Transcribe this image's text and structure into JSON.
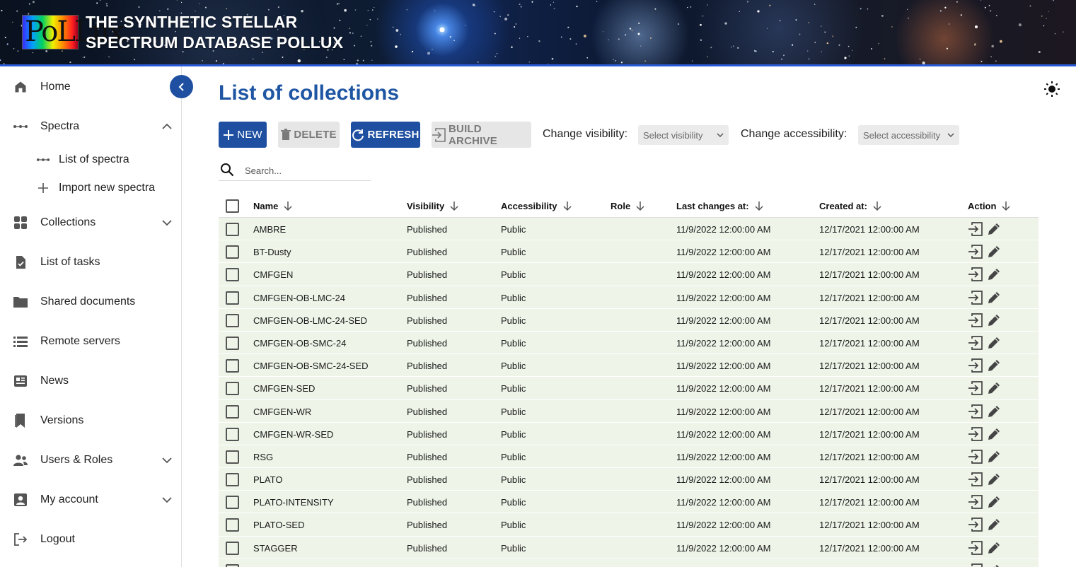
{
  "header": {
    "logo_text": "PoLLux",
    "title_line1": "THE SYNTHETIC STELLAR",
    "title_line2": "SPECTRUM DATABASE POLLUX"
  },
  "sidebar": {
    "items": [
      {
        "label": "Home"
      },
      {
        "label": "Spectra"
      },
      {
        "label": "List of spectra"
      },
      {
        "label": "Import new spectra"
      },
      {
        "label": "Collections"
      },
      {
        "label": "List of tasks"
      },
      {
        "label": "Shared documents"
      },
      {
        "label": "Remote servers"
      },
      {
        "label": "News"
      },
      {
        "label": "Versions"
      },
      {
        "label": "Users & Roles"
      },
      {
        "label": "My account"
      },
      {
        "label": "Logout"
      }
    ]
  },
  "main": {
    "title": "List of collections",
    "toolbar": {
      "new_label": "NEW",
      "delete_label": "DELETE",
      "refresh_label": "REFRESH",
      "build_archive_label": "BUILD ARCHIVE",
      "visibility_label": "Change visibility:",
      "visibility_placeholder": "Select visibility",
      "accessibility_label": "Change accessibility:",
      "accessibility_placeholder": "Select accessibility"
    },
    "search": {
      "placeholder": "Search..."
    },
    "table": {
      "columns": [
        "Name",
        "Visibility",
        "Accessibility",
        "Role",
        "Last changes at:",
        "Created at:",
        "Action"
      ],
      "rows": [
        {
          "name": "AMBRE",
          "visibility": "Published",
          "accessibility": "Public",
          "role": "",
          "last_changes": "11/9/2022 12:00:00 AM",
          "created": "12/17/2021 12:00:00 AM"
        },
        {
          "name": "BT-Dusty",
          "visibility": "Published",
          "accessibility": "Public",
          "role": "",
          "last_changes": "11/9/2022 12:00:00 AM",
          "created": "12/17/2021 12:00:00 AM"
        },
        {
          "name": "CMFGEN",
          "visibility": "Published",
          "accessibility": "Public",
          "role": "",
          "last_changes": "11/9/2022 12:00:00 AM",
          "created": "12/17/2021 12:00:00 AM"
        },
        {
          "name": "CMFGEN-OB-LMC-24",
          "visibility": "Published",
          "accessibility": "Public",
          "role": "",
          "last_changes": "11/9/2022 12:00:00 AM",
          "created": "12/17/2021 12:00:00 AM"
        },
        {
          "name": "CMFGEN-OB-LMC-24-SED",
          "visibility": "Published",
          "accessibility": "Public",
          "role": "",
          "last_changes": "11/9/2022 12:00:00 AM",
          "created": "12/17/2021 12:00:00 AM"
        },
        {
          "name": "CMFGEN-OB-SMC-24",
          "visibility": "Published",
          "accessibility": "Public",
          "role": "",
          "last_changes": "11/9/2022 12:00:00 AM",
          "created": "12/17/2021 12:00:00 AM"
        },
        {
          "name": "CMFGEN-OB-SMC-24-SED",
          "visibility": "Published",
          "accessibility": "Public",
          "role": "",
          "last_changes": "11/9/2022 12:00:00 AM",
          "created": "12/17/2021 12:00:00 AM"
        },
        {
          "name": "CMFGEN-SED",
          "visibility": "Published",
          "accessibility": "Public",
          "role": "",
          "last_changes": "11/9/2022 12:00:00 AM",
          "created": "12/17/2021 12:00:00 AM"
        },
        {
          "name": "CMFGEN-WR",
          "visibility": "Published",
          "accessibility": "Public",
          "role": "",
          "last_changes": "11/9/2022 12:00:00 AM",
          "created": "12/17/2021 12:00:00 AM"
        },
        {
          "name": "CMFGEN-WR-SED",
          "visibility": "Published",
          "accessibility": "Public",
          "role": "",
          "last_changes": "11/9/2022 12:00:00 AM",
          "created": "12/17/2021 12:00:00 AM"
        },
        {
          "name": "RSG",
          "visibility": "Published",
          "accessibility": "Public",
          "role": "",
          "last_changes": "11/9/2022 12:00:00 AM",
          "created": "12/17/2021 12:00:00 AM"
        },
        {
          "name": "PLATO",
          "visibility": "Published",
          "accessibility": "Public",
          "role": "",
          "last_changes": "11/9/2022 12:00:00 AM",
          "created": "12/17/2021 12:00:00 AM"
        },
        {
          "name": "PLATO-INTENSITY",
          "visibility": "Published",
          "accessibility": "Public",
          "role": "",
          "last_changes": "11/9/2022 12:00:00 AM",
          "created": "12/17/2021 12:00:00 AM"
        },
        {
          "name": "PLATO-SED",
          "visibility": "Published",
          "accessibility": "Public",
          "role": "",
          "last_changes": "11/9/2022 12:00:00 AM",
          "created": "12/17/2021 12:00:00 AM"
        },
        {
          "name": "STAGGER",
          "visibility": "Published",
          "accessibility": "Public",
          "role": "",
          "last_changes": "11/9/2022 12:00:00 AM",
          "created": "12/17/2021 12:00:00 AM"
        },
        {
          "name": "",
          "visibility": "",
          "accessibility": "",
          "role": "",
          "last_changes": "",
          "created": ""
        }
      ]
    }
  },
  "colors": {
    "primary": "#1e4fa1",
    "title": "#1f56a3",
    "row_bg": "#eef4e8",
    "disabled_bg": "#e6e6e6"
  }
}
